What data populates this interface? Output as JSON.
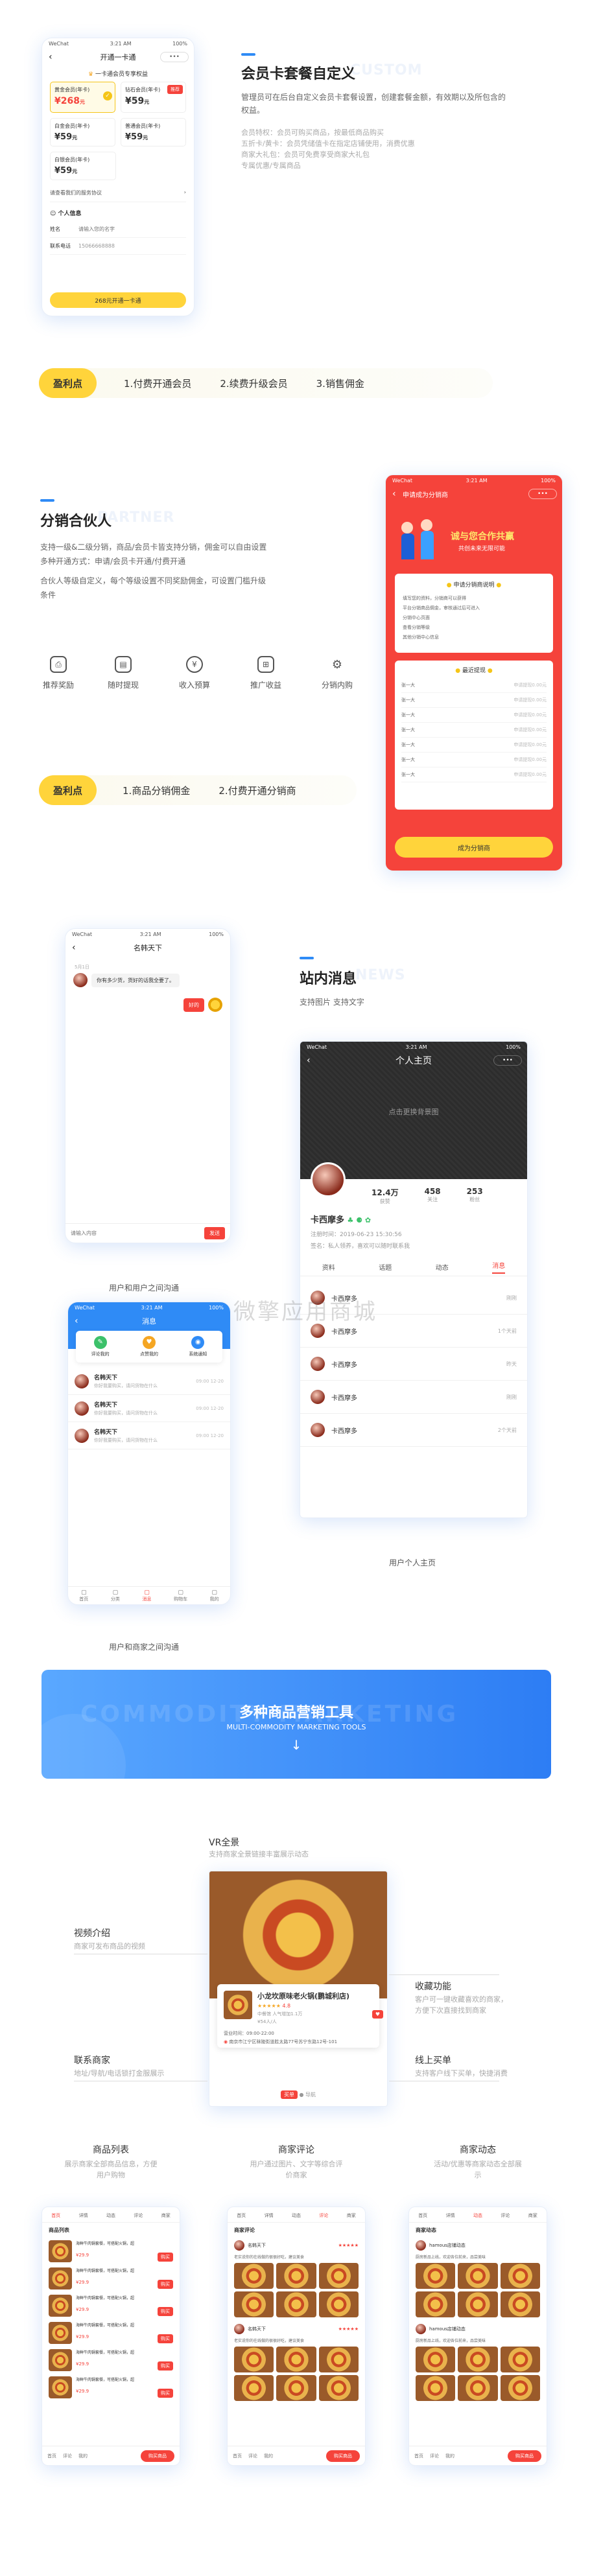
{
  "colors": {
    "accent": "#2f8bf6",
    "yellow": "#ffd43b",
    "red": "#f5433b"
  },
  "watermark": "微擎应用商城",
  "s1": {
    "title": "会员卡套餐自定义",
    "ghost": "CUSTOM",
    "desc": [
      "管理员可在后台自定义会员卡套餐设置，创建套餐金额，有效期以及所包含的",
      "权益。"
    ],
    "list": [
      "会员特权：会员可购买商品，按最低商品购买",
      "五折卡/黄卡：会员凭储值卡在指定店铺使用，消费优惠",
      "商家大礼包：会员可免费享受商家大礼包",
      "专属优惠/专属商品"
    ],
    "phone": {
      "time": "3:21 AM",
      "carrier": "WeChat",
      "battery": "100%",
      "title": "开通一卡通",
      "notice": "一卡通会员专享权益",
      "card1": {
        "label": "黄金会员(年卡)",
        "price": "268",
        "unit": "元",
        "tag": "推荐"
      },
      "card2": {
        "label": "钻石会员(年卡)",
        "price": "59",
        "unit": "元"
      },
      "card3": {
        "label": "白金会员(年卡)",
        "price": "59",
        "unit": "元"
      },
      "card4": {
        "label": "普通会员(年卡)",
        "price": "59",
        "unit": "元"
      },
      "card5": {
        "label": "白银会员(年卡)",
        "price": "59",
        "unit": "元"
      },
      "rules": "请查看我们的服务协议",
      "section": "个人信息",
      "name_label": "姓名",
      "name_ph": "请输入您的名字",
      "phone_label": "联系电话",
      "phone_val": "15066668888",
      "btn": "268元开通一卡通"
    }
  },
  "pill1": {
    "hl": "盈利点",
    "items": [
      "1.付费开通会员",
      "2.续费升级会员",
      "3.销售佣金"
    ]
  },
  "s2": {
    "title": "分销合伙人",
    "ghost": "PARTNER",
    "desc": [
      "支持一级&二级分销，商品/会员卡皆支持分销，佣金可以自由设置",
      "多种开通方式：申请/会员卡开通/付费开通",
      "合伙人等级自定义，每个等级设置不同奖励佣金，可设置门槛升级",
      "条件"
    ],
    "features": [
      "推荐奖励",
      "随时提现",
      "收入预算",
      "推广收益",
      "分销内购"
    ],
    "phone": {
      "time": "3:21 AM",
      "carrier": "WeChat",
      "battery": "100%",
      "title": "申请成为分销商",
      "banner1": "诚与您合作共赢",
      "banner2": "共创未来无限可能",
      "apply_title": "申请分销商说明",
      "rules": [
        "填写您的资料，分销商可以获得",
        "平台分销商品佣金，审核通过后可进入",
        "分销中心页面",
        "查看分销等级",
        "其他分销中心信息"
      ],
      "recent": "最近提现",
      "rows": [
        "张一大",
        "张一大",
        "张一大",
        "张一大",
        "张一大",
        "张一大",
        "张一大"
      ],
      "row_val": "申请提现0.00元",
      "btn": "成为分销商"
    }
  },
  "pill2": {
    "hl": "盈利点",
    "items": [
      "1.商品分销佣金",
      "2.付费开通分销商"
    ]
  },
  "s3": {
    "title": "站内消息",
    "ghost": "NEWS",
    "sub": "支持图片  支持文字",
    "chat": {
      "carrier": "WeChat",
      "time": "3:21 AM",
      "battery": "100%",
      "title": "名韩天下",
      "timestamp": "5月1日",
      "msg1": "你有多少货，货好的话我全要了。",
      "msg2": "好的",
      "input_ph": "请输入内容",
      "send": "发送"
    },
    "caption1": "用户和用户之间沟通",
    "msgs": {
      "carrier": "WeChat",
      "time": "3:21 AM",
      "battery": "100%",
      "title": "消息",
      "icons": [
        "评论我的",
        "点赞我的",
        "系统通知"
      ],
      "rows": [
        "名韩天下",
        "名韩天下",
        "名韩天下"
      ],
      "row_sub": "你好我要购买，请问货物在什么",
      "row_time": "09:00 12-20",
      "tabs": [
        "首页",
        "分类",
        "消息",
        "购物车",
        "我的"
      ]
    },
    "caption2": "用户和商家之间沟通",
    "profile": {
      "carrier": "WeChat",
      "time": "3:21 AM",
      "battery": "100%",
      "title": "个人主页",
      "cover": "点击更换背景图",
      "stats": [
        {
          "v": "12.4万",
          "l": "获赞"
        },
        {
          "v": "458",
          "l": "关注"
        },
        {
          "v": "253",
          "l": "粉丝"
        }
      ],
      "name": "卡西摩多",
      "reg": "注册时间：2019-06-23 15:30:56",
      "intro": "签名：私人领养，喜欢可以随时联系我",
      "tabs": [
        "资料",
        "话题",
        "动态",
        "消息"
      ],
      "rows": [
        {
          "n": "卡西摩多",
          "t": "刚刚"
        },
        {
          "n": "卡西摩多",
          "t": "1个天前"
        },
        {
          "n": "卡西摩多",
          "t": "昨天"
        },
        {
          "n": "卡西摩多",
          "t": "刚刚"
        },
        {
          "n": "卡西摩多",
          "t": "2个天前"
        }
      ]
    },
    "caption3": "用户个人主页"
  },
  "band": {
    "title": "多种商品营销工具",
    "sub": "MULTI-COMMODITY MARKETING TOOLS",
    "ghost": "COMMODITY MARKETING",
    "arrow": "↓"
  },
  "s4": {
    "vr_title": "VR全景",
    "vr_sub": "支持商家全景链接丰富展示动态",
    "video_title": "视频介绍",
    "video_sub": "商家可发布商品的视频",
    "contact_title": "联系商家",
    "contact_sub": "地址/导航/电话锁打金服展示",
    "fav_title": "收藏功能",
    "fav_sub": [
      "客户可一键收藏喜欢的商家，",
      "方便下次直接找到商家"
    ],
    "buy_title": "线上买单",
    "buy_sub": "支持客户线下买单，快捷消费",
    "shop": {
      "name": "小龙坎原味老火锅(鹏城利店)",
      "rating": "4.8",
      "cat": "中餐馆",
      "dist": "人气增加1.1万",
      "price": "¥54人/人",
      "hours": "营业时间：09:00-22:00",
      "addr": "南京市江宁区秣陵街道胜太路77号苏宁东路12号-101",
      "order": "买单",
      "map_label": "导航"
    }
  },
  "s5": {
    "cols": [
      {
        "title": "商品列表",
        "sub": [
          "展示商家全部商品信息，方便",
          "用户购物"
        ]
      },
      {
        "title": "商家评论",
        "sub": [
          "用户通过图片、文字等综合评",
          "价商家"
        ]
      },
      {
        "title": "商家动态",
        "sub": [
          "活动/优惠等商家动态全部展",
          "示"
        ]
      }
    ],
    "tabs": [
      "首页",
      "详情",
      "动态",
      "评论",
      "商家"
    ],
    "list_title": "商品列表",
    "list_item": "海鲜牛肉锅套餐，可搭配火锅，超",
    "list_price": "¥29.9",
    "list_btn": "购买",
    "review_title": "商家评论",
    "review_name": "名韩天下",
    "review_text": "老实说你的在线做的很很好吃，建议美食",
    "dyn_title": "商家动态",
    "dyn_name": "hamous店铺动态",
    "dyn_text": "厨房新品上线，欢迎各位前来，品尝美味",
    "cta": "购买商品",
    "bottom": [
      "首页",
      "评论",
      "我的"
    ]
  }
}
